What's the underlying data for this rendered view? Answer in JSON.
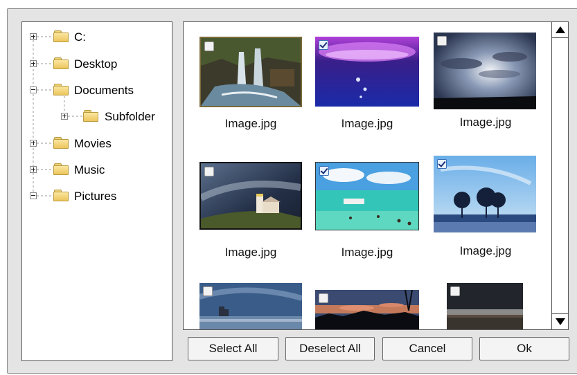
{
  "tree": {
    "nodes": [
      {
        "label": "C:",
        "expander": "plus"
      },
      {
        "label": "Desktop",
        "expander": "plus"
      },
      {
        "label": "Documents",
        "expander": "minus"
      },
      {
        "label": "Subfolder",
        "expander": "plus"
      },
      {
        "label": "Movies",
        "expander": "plus"
      },
      {
        "label": "Music",
        "expander": "plus"
      },
      {
        "label": "Pictures",
        "expander": "minus"
      }
    ]
  },
  "images": [
    {
      "caption": "Image.jpg",
      "checked": false,
      "scene": "waterfall"
    },
    {
      "caption": "Image.jpg",
      "checked": true,
      "scene": "purple-water-drops"
    },
    {
      "caption": "Image.jpg",
      "checked": false,
      "scene": "cloudy-sky"
    },
    {
      "caption": "Image.jpg",
      "checked": false,
      "scene": "lighthouse"
    },
    {
      "caption": "Image.jpg",
      "checked": true,
      "scene": "tropical-beach"
    },
    {
      "caption": "Image.jpg",
      "checked": true,
      "scene": "snowy-trees"
    },
    {
      "caption": "",
      "checked": false,
      "scene": "castle-coast"
    },
    {
      "caption": "",
      "checked": false,
      "scene": "sunset-silhouette"
    },
    {
      "caption": "",
      "checked": false,
      "scene": "dark-landscape"
    }
  ],
  "buttons": {
    "select_all": "Select All",
    "deselect_all": "Deselect All",
    "cancel": "Cancel",
    "ok": "Ok"
  },
  "icons": {
    "folder": "folder-icon",
    "scroll_up": "arrow-up-icon",
    "scroll_down": "arrow-down-icon"
  }
}
